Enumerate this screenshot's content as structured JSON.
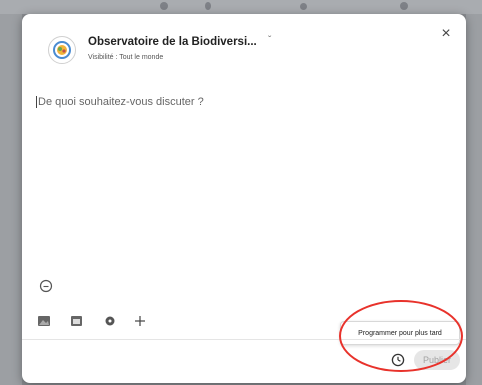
{
  "composer": {
    "author_name": "Observatoire de la Biodiversi...",
    "visibility": "Visibilité : Tout le monde",
    "placeholder": "De quoi souhaitez-vous discuter ?",
    "schedule_tooltip": "Programmer pour plus tard",
    "publish_label": "Publier",
    "close_glyph": "×",
    "caret_glyph": "ˇ",
    "tools": [
      "image-icon",
      "calendar-icon",
      "gear-icon",
      "plus-icon"
    ],
    "annotation_color": "#e8322b"
  }
}
